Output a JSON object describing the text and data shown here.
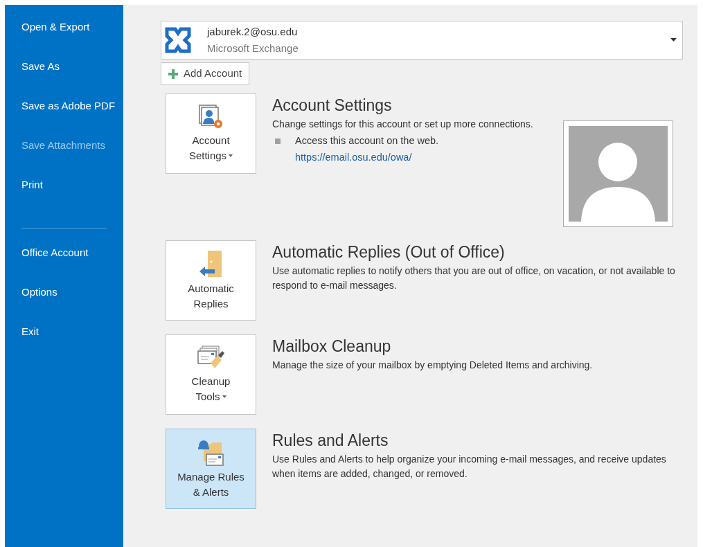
{
  "sidebar": {
    "items": [
      {
        "kind": "item",
        "label": "Open & Export",
        "disabled": false
      },
      {
        "kind": "item",
        "label": "Save As",
        "disabled": false
      },
      {
        "kind": "item",
        "label": "Save as Adobe PDF",
        "disabled": false
      },
      {
        "kind": "item",
        "label": "Save Attachments",
        "disabled": true
      },
      {
        "kind": "item",
        "label": "Print",
        "disabled": false
      },
      {
        "kind": "divider"
      },
      {
        "kind": "item",
        "label": "Office Account",
        "disabled": false
      },
      {
        "kind": "item",
        "label": "Options",
        "disabled": false
      },
      {
        "kind": "item",
        "label": "Exit",
        "disabled": false
      }
    ]
  },
  "account": {
    "email": "jaburek.2@osu.edu",
    "type": "Microsoft Exchange"
  },
  "add_account": {
    "label": "Add Account"
  },
  "sections": [
    {
      "kind": "account",
      "button": [
        "Account",
        "Settings"
      ],
      "has_menu": true,
      "selected": false,
      "title": "Account Settings",
      "description": "Change settings for this account or set up more connections.",
      "bullet": "Access this account on the web.",
      "link": "https://email.osu.edu/owa/"
    },
    {
      "kind": "feature",
      "button": [
        "Automatic",
        "Replies"
      ],
      "has_menu": false,
      "selected": false,
      "title": "Automatic Replies (Out of Office)",
      "description": "Use automatic replies to notify others that you are out of office, on vacation, or not available to respond to e-mail messages."
    },
    {
      "kind": "feature",
      "button": [
        "Cleanup",
        "Tools"
      ],
      "has_menu": true,
      "selected": false,
      "title": "Mailbox Cleanup",
      "description": "Manage the size of your mailbox by emptying Deleted Items and archiving."
    },
    {
      "kind": "feature",
      "button": [
        "Manage Rules",
        "& Alerts"
      ],
      "has_menu": false,
      "selected": true,
      "title": "Rules and Alerts",
      "description": "Use Rules and Alerts to help organize your incoming e-mail messages, and receive updates when items are added, changed, or removed."
    }
  ]
}
